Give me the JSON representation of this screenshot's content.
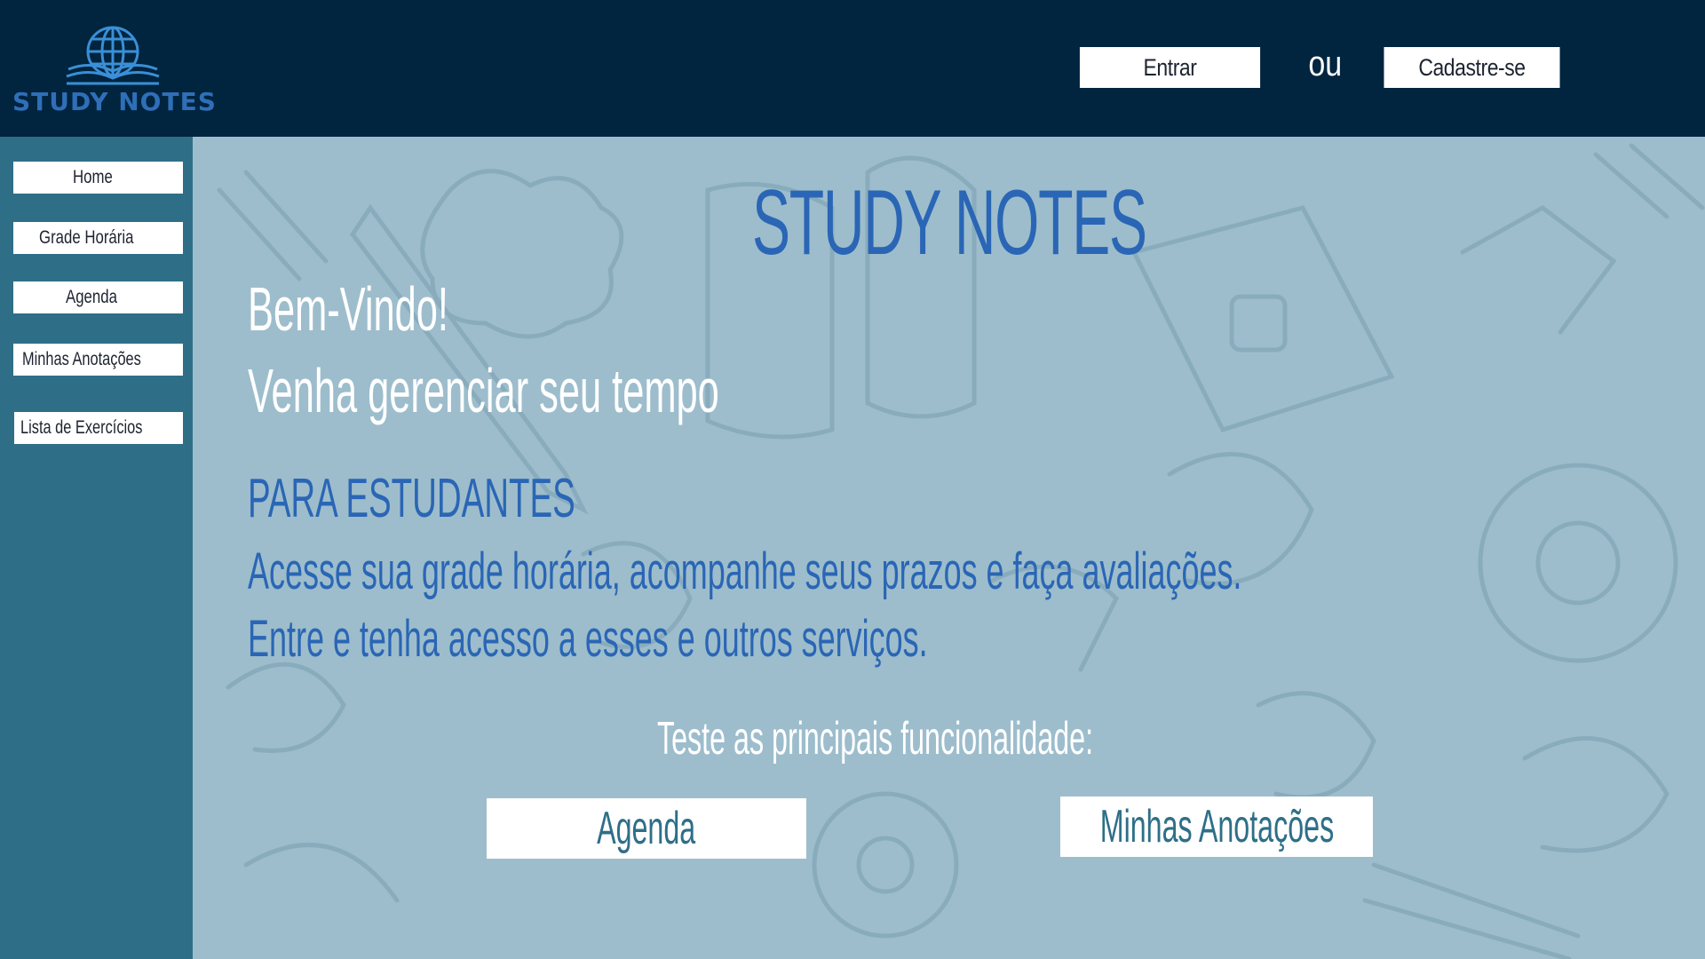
{
  "header": {
    "logo_text": "STUDY NOTES",
    "login_label": "Entrar",
    "or_label": "ou",
    "signup_label": "Cadastre-se"
  },
  "sidebar": {
    "items": [
      {
        "label": "Home"
      },
      {
        "label": "Grade Horária"
      },
      {
        "label": "Agenda"
      },
      {
        "label": "Minhas Anotações"
      },
      {
        "label": "Lista de Exercícios"
      }
    ]
  },
  "main": {
    "title": "STUDY NOTES",
    "welcome_line1": "Bem-Vindo!",
    "welcome_line2": "Venha gerenciar seu tempo",
    "students_heading": "PARA ESTUDANTES",
    "students_line1": "Acesse sua grade horária, acompanhe seus prazos e faça avaliações.",
    "students_line2": "Entre e tenha acesso a esses e outros serviços.",
    "test_prompt": "Teste as principais funcionalidade:",
    "feature_buttons": [
      {
        "label": "Agenda"
      },
      {
        "label": "Minhas Anotações"
      }
    ]
  },
  "colors": {
    "topbar": "#01243f",
    "sidebar": "#2e6f87",
    "main_bg": "#9dbdcc",
    "accent_blue": "#2a66b5"
  }
}
